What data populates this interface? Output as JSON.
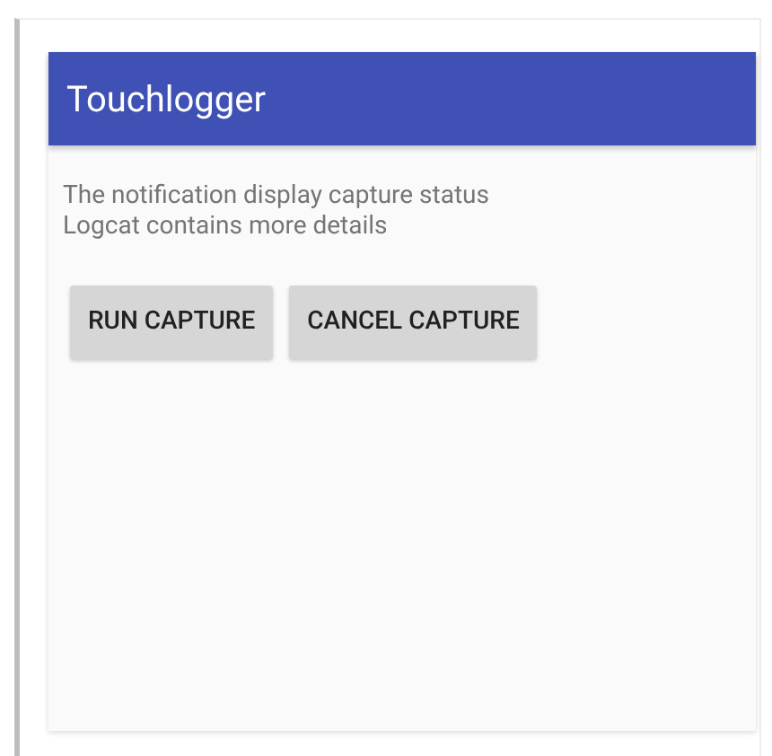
{
  "app_bar": {
    "title": "Touchlogger"
  },
  "message": [
    "The notification display capture status",
    "Logcat contains more details"
  ],
  "buttons": [
    {
      "label": "RUN CAPTURE"
    },
    {
      "label": "CANCEL CAPTURE"
    }
  ]
}
